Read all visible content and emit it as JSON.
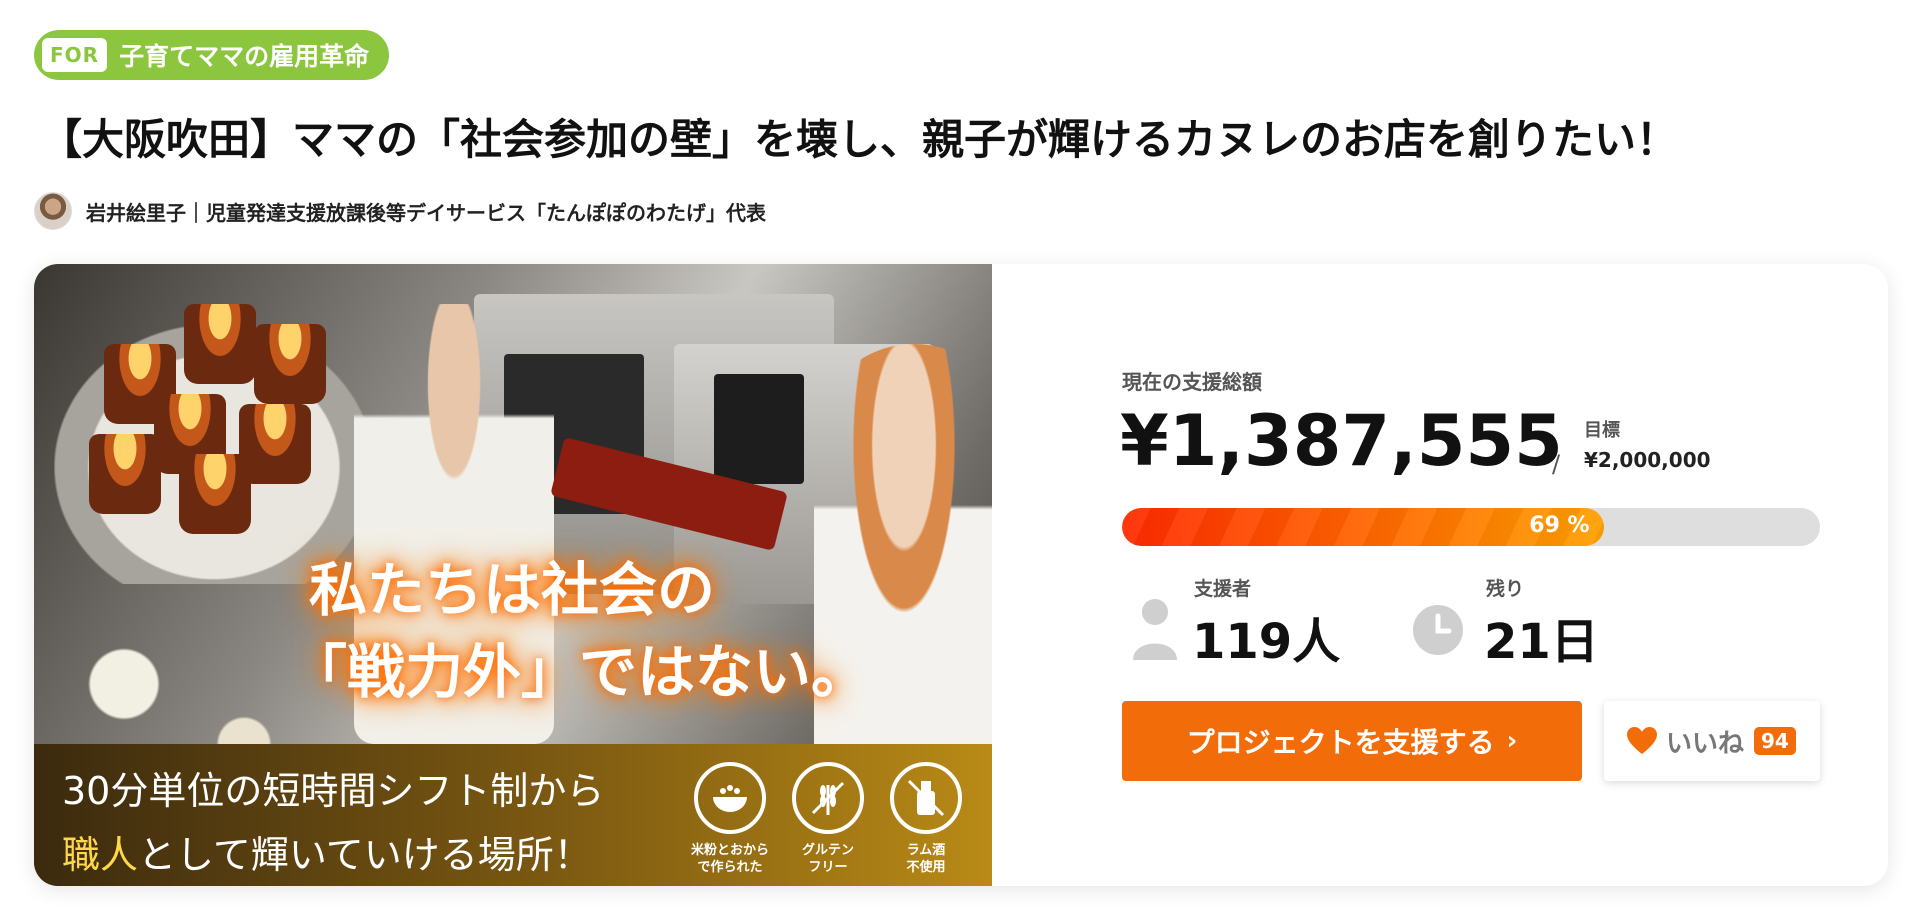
{
  "tag": {
    "prefix": "FOR",
    "label": "子育てママの雇用革命"
  },
  "title": "【大阪吹田】ママの「社会参加の壁」を壊し、親子が輝けるカヌレのお店を創りたい！",
  "author": {
    "name": "岩井絵里子｜児童発達支援放課後等デイサービス「たんぽぽのわたげ」代表"
  },
  "hero": {
    "headline_line1": "私たちは社会の",
    "headline_line2": "「戦力外」ではない。",
    "footer_line1": "30分単位の短時間シフト制から",
    "footer_line2_highlight": "職人",
    "footer_line2_rest": "として輝いていける場所！",
    "badges": [
      {
        "icon": "rice-bowl-icon",
        "caption": "米粉とおから\nで作られた"
      },
      {
        "icon": "wheat-icon",
        "caption": "グルテン\nフリー"
      },
      {
        "icon": "no-bottle-icon",
        "caption": "ラム酒\n不使用"
      }
    ]
  },
  "stats": {
    "total_label": "現在の支援総額",
    "total_amount": "¥1,387,555",
    "goal_label": "目標",
    "goal_value": "¥2,000,000",
    "progress_percent": 69,
    "progress_text": "69 %",
    "supporters_label": "支援者",
    "supporters_value": "119人",
    "remaining_label": "残り",
    "remaining_value": "21日"
  },
  "actions": {
    "support_label": "プロジェクトを支援する",
    "like_label": "いいね",
    "like_count": "94"
  },
  "colors": {
    "tag_green": "#8cc63f",
    "accent_orange": "#f36c0a",
    "progress_start": "#ff2a00",
    "progress_end": "#ffa000"
  }
}
